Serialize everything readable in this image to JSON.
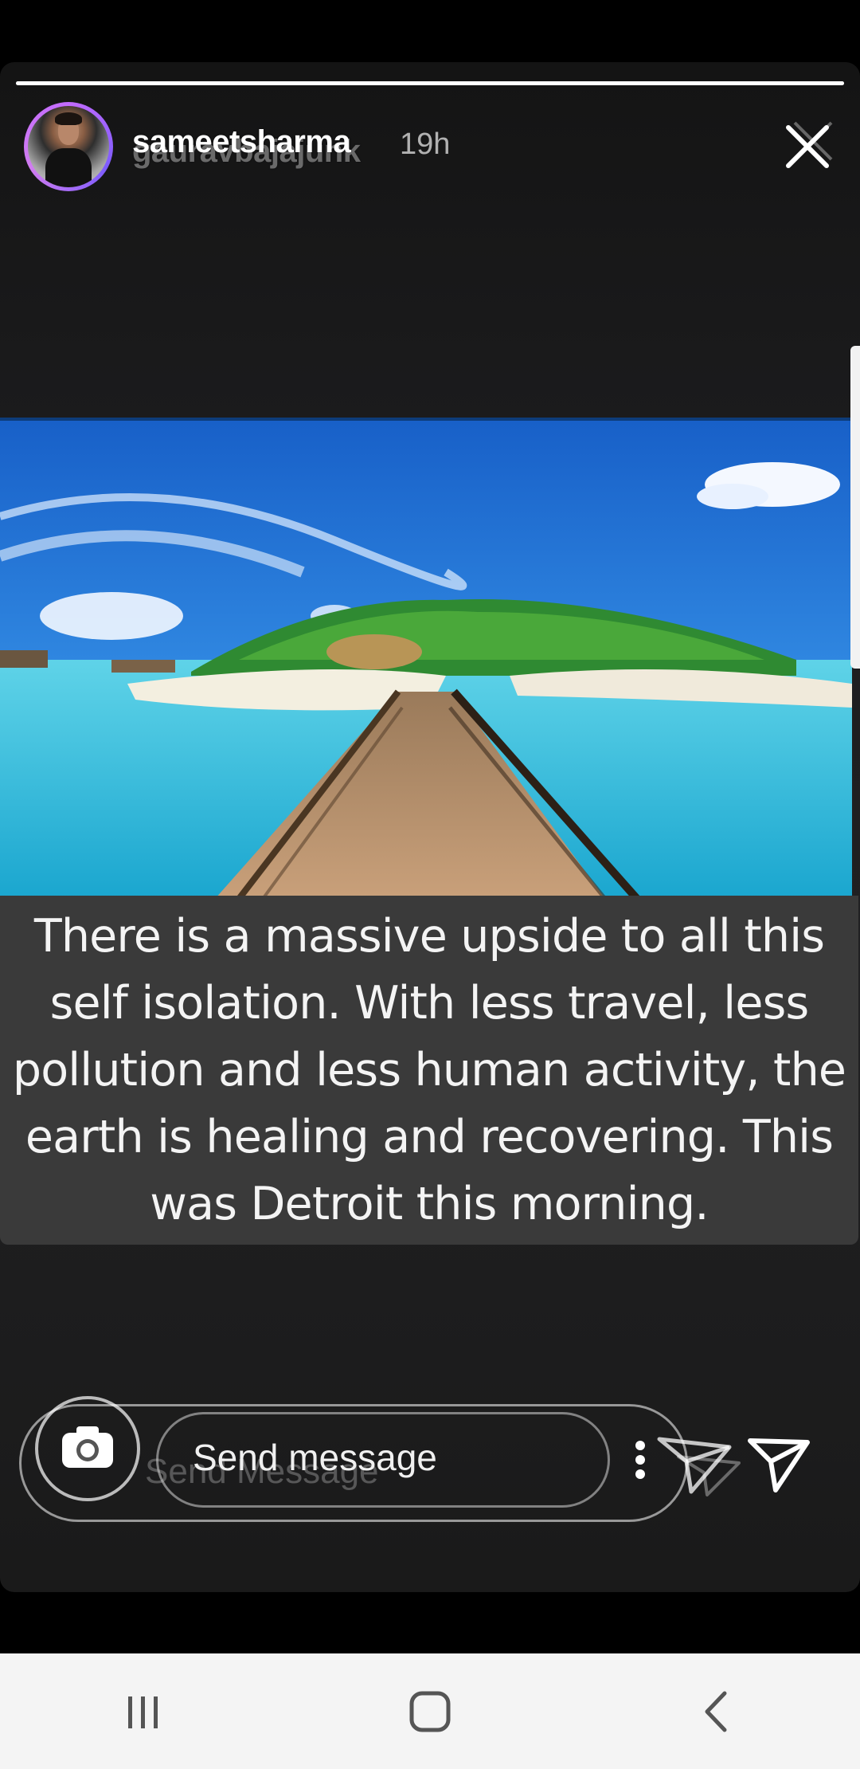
{
  "story": {
    "username": "sameetsharma",
    "username_ghost": "gauravbajajunk",
    "time": "19h",
    "progress": 1.0,
    "caption_lines": [
      "There is a massive upside to all this",
      "self isolation. With less travel, less",
      "pollution and less human activity, the",
      "earth is healing and recovering. This",
      "was Detroit this morning."
    ]
  },
  "reply": {
    "placeholder": "Send message",
    "ghost_placeholder": "Send Message"
  },
  "icons": {
    "close": "close-icon",
    "camera": "camera-icon",
    "more": "more-vertical-icon",
    "send": "send-icon",
    "nav_recents": "recents-icon",
    "nav_home": "home-icon",
    "nav_back": "back-icon"
  },
  "colors": {
    "avatar_ring": "#c36bff",
    "caption_bg": "#3a3a3a",
    "navbar_bg": "#f4f4f4"
  }
}
